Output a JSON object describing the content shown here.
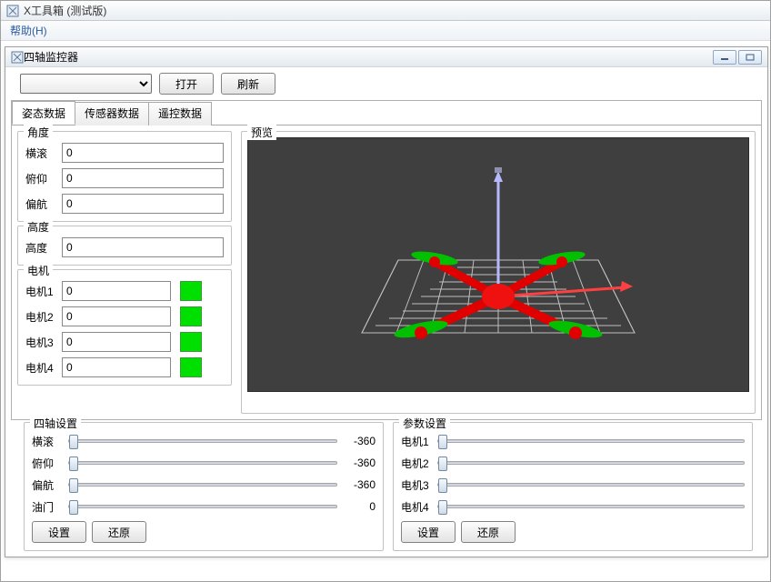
{
  "outer": {
    "title": "X工具箱 (测试版)"
  },
  "menu": {
    "help": "帮助(H)"
  },
  "inner": {
    "title": "四轴监控器"
  },
  "toolbar": {
    "open": "打开",
    "refresh": "刷新",
    "combo_selected": ""
  },
  "tabs": {
    "attitude": "姿态数据",
    "sensor": "传感器数据",
    "rc": "遥控数据"
  },
  "groups": {
    "angle": "角度",
    "altitude": "高度",
    "motor": "电机",
    "preview": "预览",
    "quad_setting": "四轴设置",
    "param_setting": "参数设置"
  },
  "angle": {
    "roll_label": "横滚",
    "roll": "0",
    "pitch_label": "俯仰",
    "pitch": "0",
    "yaw_label": "偏航",
    "yaw": "0"
  },
  "altitude": {
    "label": "高度",
    "value": "0"
  },
  "motor": {
    "m1_label": "电机1",
    "m1": "0",
    "m2_label": "电机2",
    "m2": "0",
    "m3_label": "电机3",
    "m3": "0",
    "m4_label": "电机4",
    "m4": "0",
    "color": "#00e000"
  },
  "quad": {
    "roll_label": "横滚",
    "roll_val": "-360",
    "pitch_label": "俯仰",
    "pitch_val": "-360",
    "yaw_label": "偏航",
    "yaw_val": "-360",
    "throttle_label": "油门",
    "throttle_val": "0",
    "set": "设置",
    "reset": "还原"
  },
  "param": {
    "m1_label": "电机1",
    "m2_label": "电机2",
    "m3_label": "电机3",
    "m4_label": "电机4",
    "set": "设置",
    "reset": "还原"
  }
}
